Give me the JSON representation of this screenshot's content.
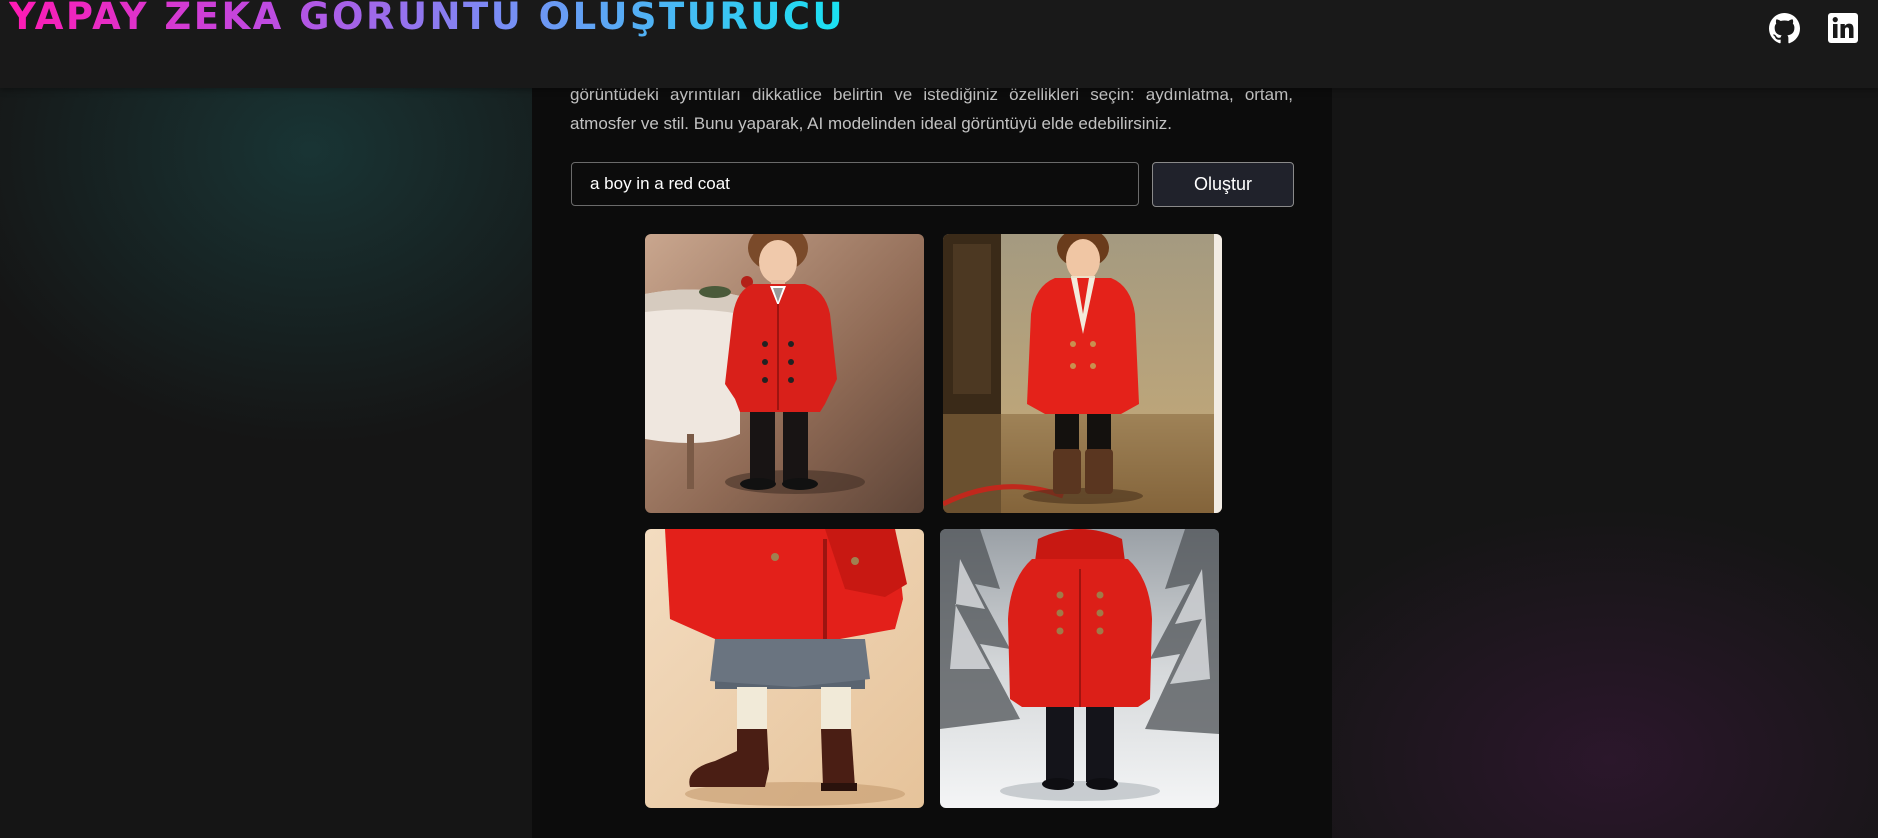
{
  "header": {
    "title": "YAPAY ZEKA GÖRÜNTÜ OLUŞTURUCU",
    "icons": [
      "github-icon",
      "linkedin-icon"
    ]
  },
  "main": {
    "description": "görüntüdeki ayrıntıları dikkatlice belirtin ve istediğiniz özellikleri seçin: aydınlatma, ortam, atmosfer ve stil. Bunu yaparak, AI modelinden ideal görüntüyü elde edebilirsiniz.",
    "prompt_value": "a boy in a red coat",
    "generate_label": "Oluştur"
  },
  "colors": {
    "background": "#151515",
    "panel": "#0c0c0c",
    "title_gradient": [
      "#ff1ab3",
      "#c049e0",
      "#7b8bf5",
      "#19e3f2"
    ],
    "coat_red": "#d9201a"
  }
}
